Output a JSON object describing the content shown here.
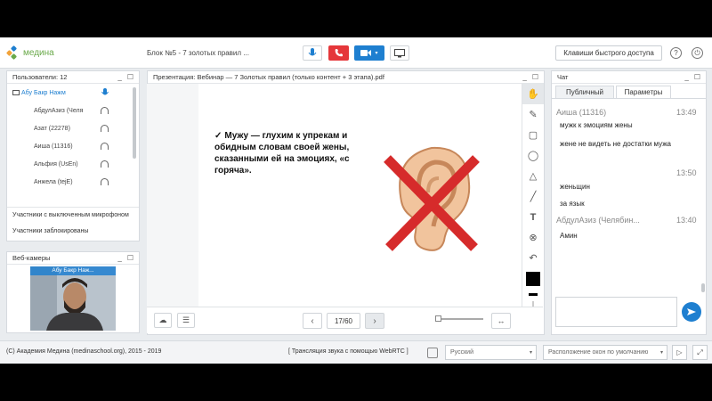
{
  "header": {
    "logo_text": "медина",
    "conference_title": "Блок №5 - 7 золотых правил ...",
    "shortcut_button": "Клавиши быстрого доступа",
    "help_icon": "?",
    "exit_icon": "⏻"
  },
  "users_panel": {
    "title": "Пользователи: 12",
    "users": [
      {
        "name": "Абу Бакр Нажм",
        "self": true
      },
      {
        "name": "АбдулАзиз (Челя"
      },
      {
        "name": "Азат (22278)"
      },
      {
        "name": "Аиша (11316)"
      },
      {
        "name": "Альфия (UsEn)"
      },
      {
        "name": "Анжела (tejE)"
      }
    ],
    "muted_label": "Участники с выключенным микрофоном",
    "blocked_label": "Участники заблокированы"
  },
  "webcams_panel": {
    "title": "Веб-камеры",
    "cam_name": "Абу Бакр Наж..."
  },
  "presentation": {
    "title": "Презентация: Вебинар — 7 Золотых правил (только контент + 3 этапа).pdf",
    "slide_text": "Мужу — глухим к упрекам и обидным словам своей жены, сказанными ей на эмоциях, «с горяча».",
    "checkmark": "✓",
    "page": "17/60"
  },
  "chat": {
    "title": "Чат",
    "tab_public": "Публичный",
    "tab_params": "Параметры",
    "messages": [
      {
        "author": "Аиша (11316)",
        "time": "13:49",
        "lines": [
          "мужк к эмоциям жены",
          "жене не видеть не достатки мужа"
        ]
      },
      {
        "time": "13:50",
        "lines": [
          "женьщин",
          "за язык"
        ]
      },
      {
        "author": "АбдулАзиз (Челябин...",
        "time": "13:40",
        "lines": [
          "Амин"
        ]
      }
    ]
  },
  "footer": {
    "copyright": "(С) Академия Медина (medinaschool.org), 2015 - 2019",
    "webrtc_notice": "[ Трансляция звука с помощью WebRTC ]",
    "language": "Русский",
    "layout": "Расположение окон по умолчанию"
  },
  "colors": {
    "accent_blue": "#1e7fd0",
    "hangup_red": "#e5373a",
    "logo_green": "#6aa94a",
    "self_user_blue": "#1e7fd0"
  }
}
